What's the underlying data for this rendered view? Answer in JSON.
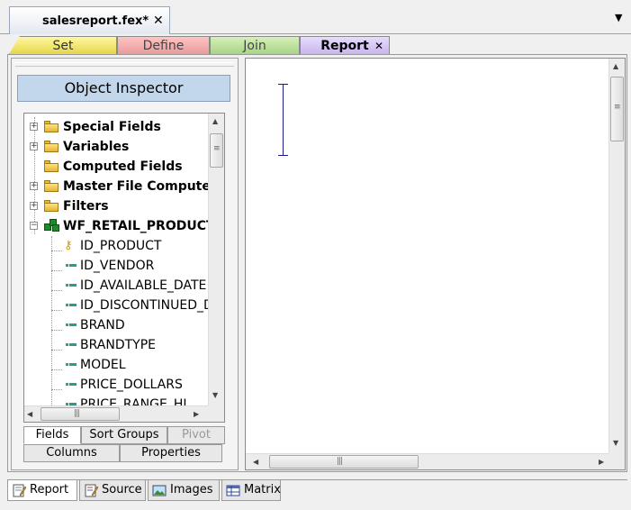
{
  "document": {
    "tab_label": "salesreport.fex*",
    "close_glyph": "✕",
    "dropdown_glyph": "▼"
  },
  "mode_tabs": [
    {
      "label": "Set",
      "color": "#e6d64a"
    },
    {
      "label": "Define",
      "color": "#e89b9b"
    },
    {
      "label": "Join",
      "color": "#a8d487"
    },
    {
      "label": "Report",
      "color": "#c8b5ee",
      "active": true,
      "close_glyph": "✕"
    }
  ],
  "inspector": {
    "title": "Object Inspector",
    "tree": [
      {
        "label": "Special Fields",
        "kind": "folder",
        "expander": "+"
      },
      {
        "label": "Variables",
        "kind": "folder",
        "expander": "+"
      },
      {
        "label": "Computed Fields",
        "kind": "folder",
        "expander": ""
      },
      {
        "label": "Master File Computed",
        "kind": "folder",
        "expander": "+"
      },
      {
        "label": "Filters",
        "kind": "folder",
        "expander": "+"
      },
      {
        "label": "WF_RETAIL_PRODUCT",
        "kind": "table",
        "expander": "−"
      },
      {
        "label": "ID_PRODUCT",
        "kind": "key-field"
      },
      {
        "label": "ID_VENDOR",
        "kind": "field"
      },
      {
        "label": "ID_AVAILABLE_DATE",
        "kind": "field"
      },
      {
        "label": "ID_DISCONTINUED_DATE",
        "kind": "field"
      },
      {
        "label": "BRAND",
        "kind": "field"
      },
      {
        "label": "BRANDTYPE",
        "kind": "field"
      },
      {
        "label": "MODEL",
        "kind": "field"
      },
      {
        "label": "PRICE_DOLLARS",
        "kind": "field"
      },
      {
        "label": "PRICE_RANGE_HI",
        "kind": "field"
      }
    ],
    "tabs_row1": [
      {
        "label": "Fields",
        "active": true
      },
      {
        "label": "Sort Groups"
      },
      {
        "label": "Pivot",
        "disabled": true
      }
    ],
    "tabs_row2": [
      {
        "label": "Columns"
      },
      {
        "label": "Properties"
      }
    ]
  },
  "bottom_tabs": [
    {
      "label": "Report",
      "icon": "report-icon",
      "active": true
    },
    {
      "label": "Source",
      "icon": "source-icon"
    },
    {
      "label": "Images",
      "icon": "images-icon"
    },
    {
      "label": "Matrix",
      "icon": "matrix-icon"
    }
  ],
  "scroll_glyphs": {
    "up": "▲",
    "down": "▼",
    "left": "◀",
    "right": "▶",
    "grip_v": "≡",
    "grip_h": "|||"
  }
}
